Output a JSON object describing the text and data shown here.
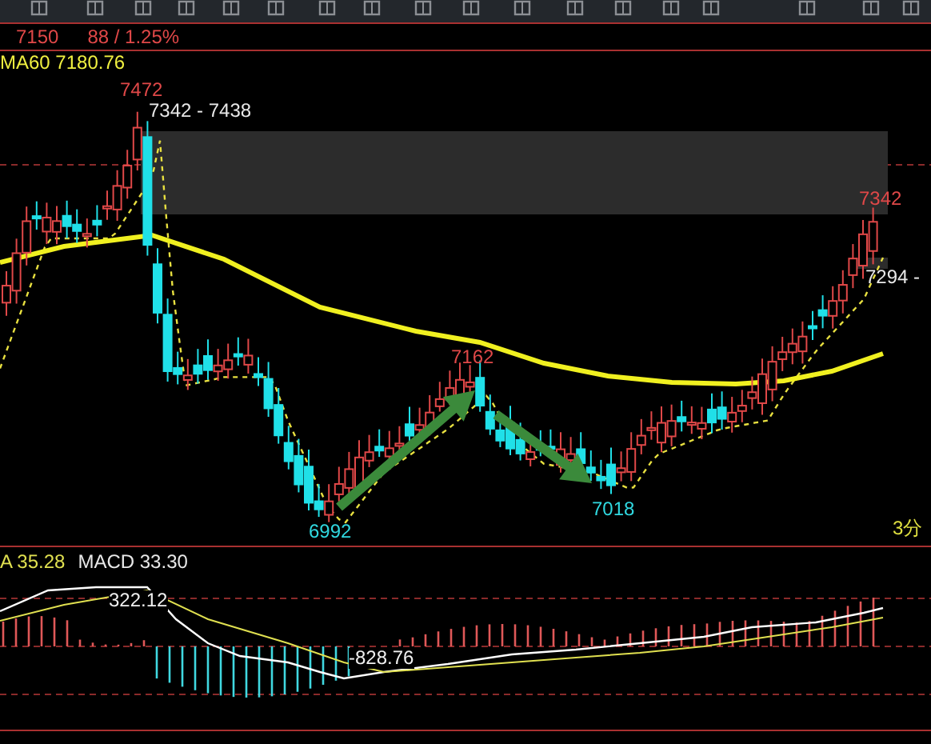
{
  "quote": {
    "price": "7150",
    "change": "88 / 1.25%"
  },
  "main_chart": {
    "indicator": "MA60 7180.76",
    "period": "3分",
    "labels": [
      {
        "text": "7472",
        "kind": "high"
      },
      {
        "text": "7342 - 7438",
        "kind": "range"
      },
      {
        "text": "7342",
        "kind": "high"
      },
      {
        "text": "7294 -",
        "kind": "range"
      },
      {
        "text": "7162",
        "kind": "high"
      },
      {
        "text": "7018",
        "kind": "low"
      },
      {
        "text": "6992",
        "kind": "low"
      }
    ]
  },
  "macd_panel": {
    "indicators": [
      {
        "text": "A 35.28",
        "kind": "dea"
      },
      {
        "text": "MACD 33.30",
        "kind": "macd"
      }
    ],
    "labels": [
      {
        "text": "322.12"
      },
      {
        "text": "-828.76"
      }
    ]
  }
}
